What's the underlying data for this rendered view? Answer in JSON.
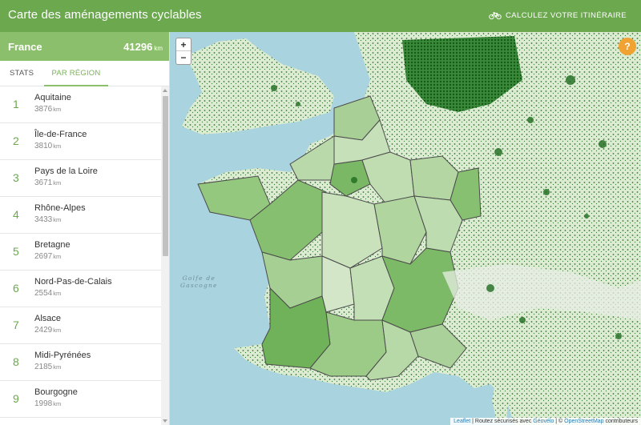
{
  "header": {
    "title": "Carte des aménagements cyclables",
    "itinerary_label": "CALCULEZ VOTRE ITINÉRAIRE"
  },
  "country": {
    "name": "France",
    "total": "41296",
    "unit": "km"
  },
  "tabs": [
    {
      "label": "STATS",
      "active": false
    },
    {
      "label": "PAR RÉGION",
      "active": true
    }
  ],
  "regions": [
    {
      "rank": "1",
      "name": "Aquitaine",
      "km": "3876",
      "unit": "km"
    },
    {
      "rank": "2",
      "name": "Île-de-France",
      "km": "3810",
      "unit": "km"
    },
    {
      "rank": "3",
      "name": "Pays de la Loire",
      "km": "3671",
      "unit": "km"
    },
    {
      "rank": "4",
      "name": "Rhône-Alpes",
      "km": "3433",
      "unit": "km"
    },
    {
      "rank": "5",
      "name": "Bretagne",
      "km": "2697",
      "unit": "km"
    },
    {
      "rank": "6",
      "name": "Nord-Pas-de-Calais",
      "km": "2554",
      "unit": "km"
    },
    {
      "rank": "7",
      "name": "Alsace",
      "km": "2429",
      "unit": "km"
    },
    {
      "rank": "8",
      "name": "Midi-Pyrénées",
      "km": "2185",
      "unit": "km"
    },
    {
      "rank": "9",
      "name": "Bourgogne",
      "km": "1998",
      "unit": "km"
    }
  ],
  "map": {
    "zoom_in": "+",
    "zoom_out": "−",
    "help": "?",
    "sea_label_line1": "Golfe de",
    "sea_label_line2": "Gascogne",
    "attribution": {
      "leaflet": "Leaflet",
      "text1": " | Routez sécurisés avec ",
      "geovelo": "Géovélo",
      "text2": " | © ",
      "osm": "OpenStreetMap",
      "text3": " contributeurs"
    }
  },
  "colors": {
    "header": "#6ba84e",
    "country_bar": "#8cbf6b",
    "accent": "#7ab159",
    "help": "#f0a232",
    "sea": "#a9d3df",
    "bike_paths": "#1f6b1f"
  }
}
